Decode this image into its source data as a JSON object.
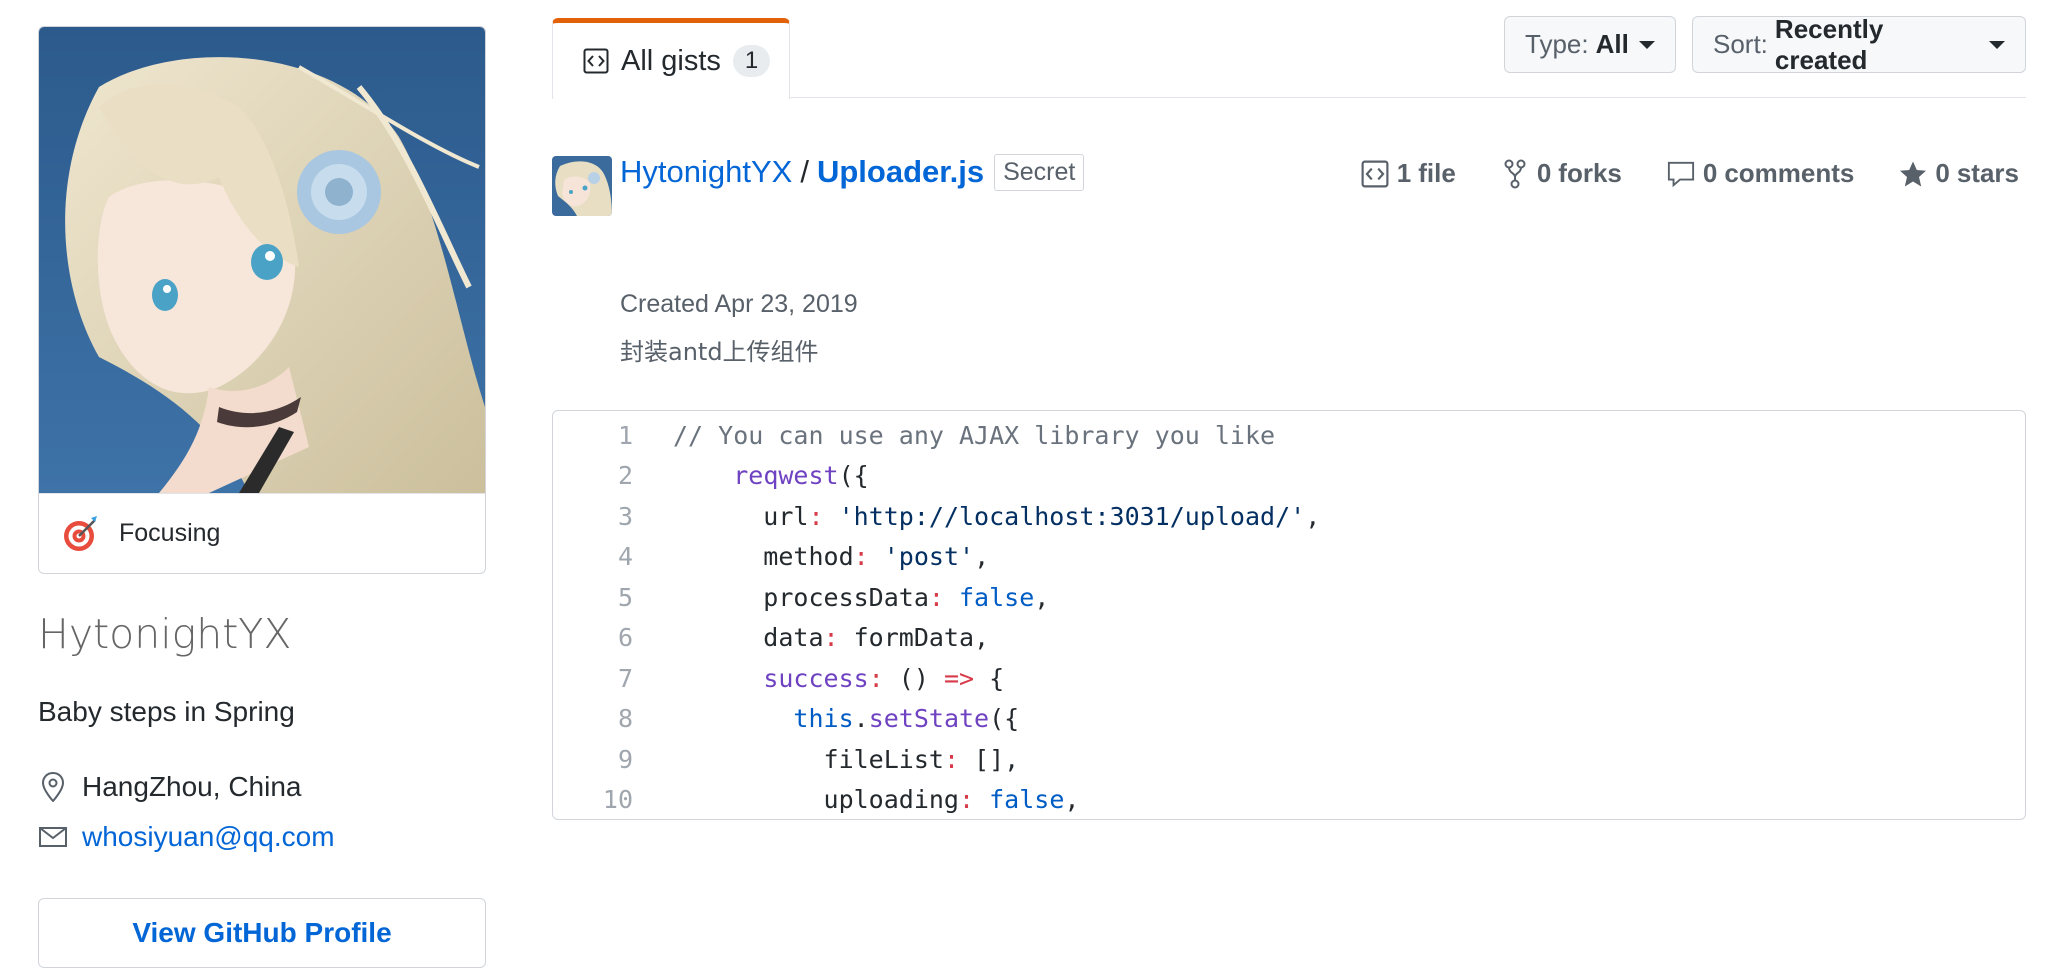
{
  "profile": {
    "status_text": "Focusing",
    "status_emoji": "dart",
    "name": "HytonightYX",
    "bio": "Baby steps in Spring",
    "location": "HangZhou, China",
    "email": "whosiyuan@qq.com",
    "view_profile_label": "View GitHub Profile"
  },
  "tabs": [
    {
      "label": "All gists",
      "count": "1",
      "icon": "code-square-icon"
    }
  ],
  "filters": {
    "type_label": "Type:",
    "type_value": "All",
    "sort_label": "Sort:",
    "sort_value": "Recently created"
  },
  "gist": {
    "owner": "HytonightYX",
    "separator": "/",
    "filename": "Uploader.js",
    "visibility": "Secret",
    "created": "Created Apr 23, 2019",
    "description": "封装antd上传组件",
    "stats": {
      "files_count": "1",
      "files_label": "file",
      "forks_count": "0",
      "forks_label": "forks",
      "comments_count": "0",
      "comments_label": "comments",
      "stars_count": "0",
      "stars_label": "stars"
    },
    "code_lines": [
      {
        "n": "1",
        "tokens": [
          [
            "comment",
            "// You can use any AJAX library you like"
          ]
        ]
      },
      {
        "n": "2",
        "tokens": [
          [
            "plain",
            "    "
          ],
          [
            "fn",
            "reqwest"
          ],
          [
            "plain",
            "({"
          ]
        ]
      },
      {
        "n": "3",
        "tokens": [
          [
            "plain",
            "      url"
          ],
          [
            "op",
            ":"
          ],
          [
            "plain",
            " "
          ],
          [
            "str",
            "'http://localhost:3031/upload/'"
          ],
          [
            "plain",
            ","
          ]
        ]
      },
      {
        "n": "4",
        "tokens": [
          [
            "plain",
            "      method"
          ],
          [
            "op",
            ":"
          ],
          [
            "plain",
            " "
          ],
          [
            "str",
            "'post'"
          ],
          [
            "plain",
            ","
          ]
        ]
      },
      {
        "n": "5",
        "tokens": [
          [
            "plain",
            "      processData"
          ],
          [
            "op",
            ":"
          ],
          [
            "plain",
            " "
          ],
          [
            "const",
            "false"
          ],
          [
            "plain",
            ","
          ]
        ]
      },
      {
        "n": "6",
        "tokens": [
          [
            "plain",
            "      data"
          ],
          [
            "op",
            ":"
          ],
          [
            "plain",
            " formData,"
          ]
        ]
      },
      {
        "n": "7",
        "tokens": [
          [
            "plain",
            "      "
          ],
          [
            "fn",
            "success"
          ],
          [
            "op",
            ":"
          ],
          [
            "plain",
            " () "
          ],
          [
            "op",
            "=>"
          ],
          [
            "plain",
            " {"
          ]
        ]
      },
      {
        "n": "8",
        "tokens": [
          [
            "plain",
            "        "
          ],
          [
            "const",
            "this"
          ],
          [
            "plain",
            "."
          ],
          [
            "fn",
            "setState"
          ],
          [
            "plain",
            "({"
          ]
        ]
      },
      {
        "n": "9",
        "tokens": [
          [
            "plain",
            "          fileList"
          ],
          [
            "op",
            ":"
          ],
          [
            "plain",
            " [],"
          ]
        ]
      },
      {
        "n": "10",
        "tokens": [
          [
            "plain",
            "          uploading"
          ],
          [
            "op",
            ":"
          ],
          [
            "plain",
            " "
          ],
          [
            "const",
            "false"
          ],
          [
            "plain",
            ","
          ]
        ]
      }
    ]
  },
  "colors": {
    "link": "#0366d6",
    "tab_accent": "#e36209",
    "border": "#d1d5da",
    "muted": "#586069"
  }
}
